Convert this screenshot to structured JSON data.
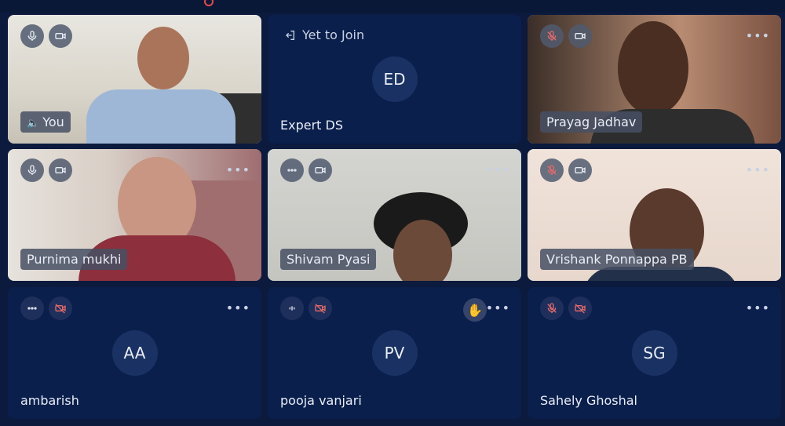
{
  "tiles": [
    {
      "id": "you",
      "name": "You",
      "kind": "video",
      "mic": "on",
      "cam": "on"
    },
    {
      "id": "expert",
      "name": "Expert DS",
      "kind": "avatar",
      "initials": "ED",
      "status": "Yet to Join"
    },
    {
      "id": "prayag",
      "name": "Prayag Jadhav",
      "kind": "video",
      "mic": "off",
      "cam": "on"
    },
    {
      "id": "purnima",
      "name": "Purnima mukhi",
      "kind": "video",
      "mic": "on",
      "cam": "on"
    },
    {
      "id": "shivam",
      "name": "Shivam Pyasi",
      "kind": "video",
      "mic": "more",
      "cam": "on"
    },
    {
      "id": "vrishank",
      "name": "Vrishank Ponnappa PB",
      "kind": "video",
      "mic": "off",
      "cam": "on"
    },
    {
      "id": "ambarish",
      "name": "ambarish",
      "kind": "avatar",
      "initials": "AA",
      "mic": "more",
      "cam": "off"
    },
    {
      "id": "pooja",
      "name": "pooja vanjari",
      "kind": "avatar",
      "initials": "PV",
      "mic": "speaking",
      "cam": "off",
      "hand_raised": true
    },
    {
      "id": "sahely",
      "name": "Sahely Ghoshal",
      "kind": "avatar",
      "initials": "SG",
      "mic": "off",
      "cam": "off"
    }
  ],
  "colors": {
    "background": "#0b1a3d",
    "tile": "#0a1f4c",
    "muted": "#e36a6a"
  }
}
